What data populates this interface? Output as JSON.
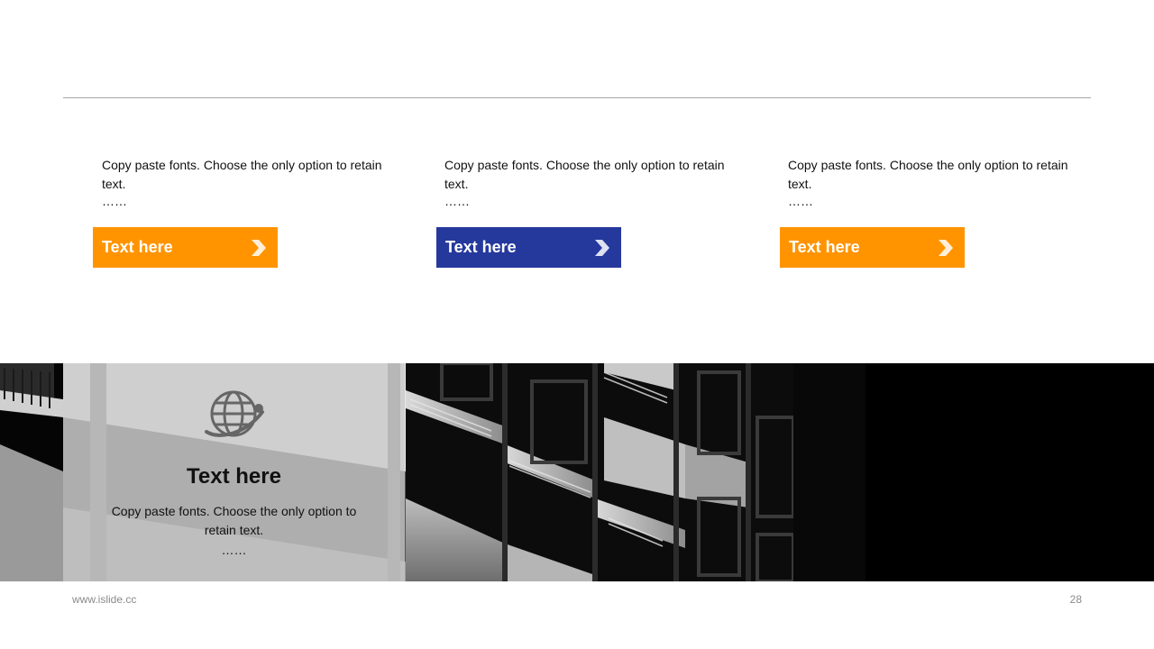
{
  "columns": [
    {
      "text": "Copy paste fonts. Choose the only option to retain text.",
      "ellipsis": "……",
      "button_label": "Text here",
      "button_color": "#ff9400"
    },
    {
      "text": "Copy paste fonts. Choose the only option to retain text.",
      "ellipsis": "……",
      "button_label": "Text here",
      "button_color": "#25399d"
    },
    {
      "text": "Copy paste fonts. Choose the only option to retain text.",
      "ellipsis": "……",
      "button_label": "Text here",
      "button_color": "#ff9400"
    }
  ],
  "feature_panel": {
    "icon": "globe-icon",
    "title": "Text here",
    "body": "Copy paste fonts. Choose the only option to retain text.",
    "ellipsis": "……"
  },
  "footer": {
    "url": "www.islide.cc",
    "page_number": "28"
  },
  "colors": {
    "accent_orange": "#ff9400",
    "accent_blue": "#25399d"
  }
}
